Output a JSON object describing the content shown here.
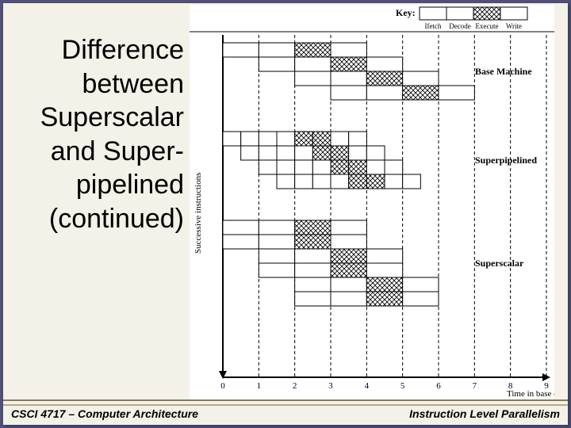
{
  "title": {
    "line1": "Difference",
    "line2": "between",
    "line3": "Superscalar",
    "line4": "and Super-",
    "line5": "pipelined",
    "line6": "(continued)"
  },
  "footer": {
    "left": "CSCI 4717 – Computer Architecture",
    "right": "Instruction Level Parallelism"
  },
  "diagram": {
    "key": {
      "title": "Key:",
      "stages": [
        "Ifetch",
        "Decode",
        "Execute",
        "Write"
      ],
      "patterns": [
        "none",
        "none",
        "cross",
        "none"
      ]
    },
    "ylabel": "Successive instructions",
    "xlabel": "Time in base cycles",
    "x_ticks": [
      0,
      1,
      2,
      3,
      4,
      5,
      6,
      7,
      8,
      9
    ],
    "groups": [
      {
        "label": "Base Machine",
        "rows": [
          {
            "start": 0,
            "cells": [
              [
                "n",
                1
              ],
              [
                "n",
                1
              ],
              [
                "x",
                1
              ],
              [
                "n",
                1
              ]
            ]
          },
          {
            "start": 1,
            "cells": [
              [
                "n",
                1
              ],
              [
                "n",
                1
              ],
              [
                "x",
                1
              ],
              [
                "n",
                1
              ]
            ]
          },
          {
            "start": 2,
            "cells": [
              [
                "n",
                1
              ],
              [
                "n",
                1
              ],
              [
                "x",
                1
              ],
              [
                "n",
                1
              ]
            ]
          },
          {
            "start": 3,
            "cells": [
              [
                "n",
                1
              ],
              [
                "n",
                1
              ],
              [
                "x",
                1
              ],
              [
                "n",
                1
              ]
            ]
          }
        ]
      },
      {
        "label": "Superpipelined",
        "rows": [
          {
            "start": 0.0,
            "cells": [
              [
                "n",
                0.5
              ],
              [
                "n",
                0.5
              ],
              [
                "n",
                0.5
              ],
              [
                "n",
                0.5
              ],
              [
                "x",
                0.5
              ],
              [
                "x",
                0.5
              ],
              [
                "n",
                0.5
              ],
              [
                "n",
                0.5
              ]
            ]
          },
          {
            "start": 0.5,
            "cells": [
              [
                "n",
                0.5
              ],
              [
                "n",
                0.5
              ],
              [
                "n",
                0.5
              ],
              [
                "n",
                0.5
              ],
              [
                "x",
                0.5
              ],
              [
                "x",
                0.5
              ],
              [
                "n",
                0.5
              ],
              [
                "n",
                0.5
              ]
            ]
          },
          {
            "start": 1.0,
            "cells": [
              [
                "n",
                0.5
              ],
              [
                "n",
                0.5
              ],
              [
                "n",
                0.5
              ],
              [
                "n",
                0.5
              ],
              [
                "x",
                0.5
              ],
              [
                "x",
                0.5
              ],
              [
                "n",
                0.5
              ],
              [
                "n",
                0.5
              ]
            ]
          },
          {
            "start": 1.5,
            "cells": [
              [
                "n",
                0.5
              ],
              [
                "n",
                0.5
              ],
              [
                "n",
                0.5
              ],
              [
                "n",
                0.5
              ],
              [
                "x",
                0.5
              ],
              [
                "x",
                0.5
              ],
              [
                "n",
                0.5
              ],
              [
                "n",
                0.5
              ]
            ]
          }
        ]
      },
      {
        "label": "Superscalar",
        "rows": [
          {
            "start": 0,
            "cells": [
              [
                "n",
                1
              ],
              [
                "n",
                1
              ],
              [
                "x",
                1
              ],
              [
                "n",
                1
              ]
            ]
          },
          {
            "start": 0,
            "cells": [
              [
                "n",
                1
              ],
              [
                "n",
                1
              ],
              [
                "x",
                1
              ],
              [
                "n",
                1
              ]
            ]
          },
          {
            "start": 1,
            "cells": [
              [
                "n",
                1
              ],
              [
                "n",
                1
              ],
              [
                "x",
                1
              ],
              [
                "n",
                1
              ]
            ]
          },
          {
            "start": 1,
            "cells": [
              [
                "n",
                1
              ],
              [
                "n",
                1
              ],
              [
                "x",
                1
              ],
              [
                "n",
                1
              ]
            ]
          },
          {
            "start": 2,
            "cells": [
              [
                "n",
                1
              ],
              [
                "n",
                1
              ],
              [
                "x",
                1
              ],
              [
                "n",
                1
              ]
            ]
          },
          {
            "start": 2,
            "cells": [
              [
                "n",
                1
              ],
              [
                "n",
                1
              ],
              [
                "x",
                1
              ],
              [
                "n",
                1
              ]
            ]
          }
        ]
      }
    ]
  }
}
